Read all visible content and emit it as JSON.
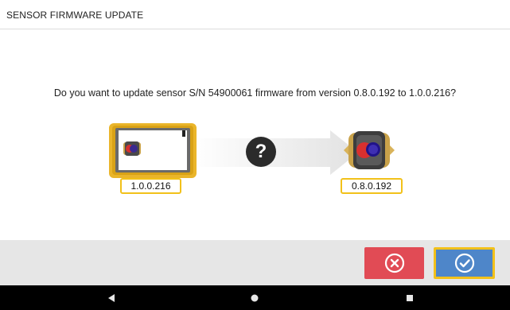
{
  "header": {
    "title": "SENSOR FIRMWARE UPDATE"
  },
  "dialog": {
    "prompt": "Do you want to update sensor S/N 54900061 firmware from version 0.8.0.192 to 1.0.0.216?",
    "question_mark": "?",
    "target_version": "1.0.0.216",
    "current_version": "0.8.0.192"
  },
  "actions": {
    "cancel_icon": "x-circle-icon",
    "confirm_icon": "check-circle-icon"
  },
  "colors": {
    "cancel": "#e14b55",
    "confirm": "#4e86c9",
    "highlight": "#f2c11a",
    "device_frame": "#eab52a"
  },
  "system_nav": {
    "back_icon": "back-triangle-icon",
    "home_icon": "home-circle-icon",
    "recent_icon": "recent-square-icon"
  }
}
